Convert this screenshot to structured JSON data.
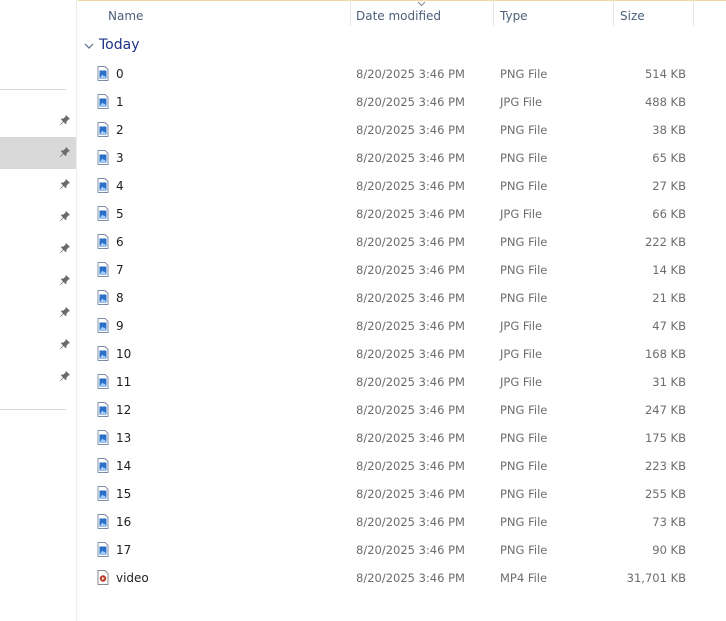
{
  "header": {
    "name": "Name",
    "date_modified": "Date modified",
    "type": "Type",
    "size": "Size"
  },
  "group": {
    "label": "Today"
  },
  "nav": {
    "pinned_count": 9,
    "selected_index": 1
  },
  "files": [
    {
      "name": "0",
      "date": "8/20/2025 3:46 PM",
      "type": "PNG File",
      "size": "514 KB",
      "icon": "image-file-icon"
    },
    {
      "name": "1",
      "date": "8/20/2025 3:46 PM",
      "type": "JPG File",
      "size": "488 KB",
      "icon": "image-file-icon"
    },
    {
      "name": "2",
      "date": "8/20/2025 3:46 PM",
      "type": "PNG File",
      "size": "38 KB",
      "icon": "image-file-icon"
    },
    {
      "name": "3",
      "date": "8/20/2025 3:46 PM",
      "type": "PNG File",
      "size": "65 KB",
      "icon": "image-file-icon"
    },
    {
      "name": "4",
      "date": "8/20/2025 3:46 PM",
      "type": "PNG File",
      "size": "27 KB",
      "icon": "image-file-icon"
    },
    {
      "name": "5",
      "date": "8/20/2025 3:46 PM",
      "type": "JPG File",
      "size": "66 KB",
      "icon": "image-file-icon"
    },
    {
      "name": "6",
      "date": "8/20/2025 3:46 PM",
      "type": "PNG File",
      "size": "222 KB",
      "icon": "image-file-icon"
    },
    {
      "name": "7",
      "date": "8/20/2025 3:46 PM",
      "type": "PNG File",
      "size": "14 KB",
      "icon": "image-file-icon"
    },
    {
      "name": "8",
      "date": "8/20/2025 3:46 PM",
      "type": "PNG File",
      "size": "21 KB",
      "icon": "image-file-icon"
    },
    {
      "name": "9",
      "date": "8/20/2025 3:46 PM",
      "type": "JPG File",
      "size": "47 KB",
      "icon": "image-file-icon"
    },
    {
      "name": "10",
      "date": "8/20/2025 3:46 PM",
      "type": "JPG File",
      "size": "168 KB",
      "icon": "image-file-icon"
    },
    {
      "name": "11",
      "date": "8/20/2025 3:46 PM",
      "type": "JPG File",
      "size": "31 KB",
      "icon": "image-file-icon"
    },
    {
      "name": "12",
      "date": "8/20/2025 3:46 PM",
      "type": "PNG File",
      "size": "247 KB",
      "icon": "image-file-icon"
    },
    {
      "name": "13",
      "date": "8/20/2025 3:46 PM",
      "type": "PNG File",
      "size": "175 KB",
      "icon": "image-file-icon"
    },
    {
      "name": "14",
      "date": "8/20/2025 3:46 PM",
      "type": "PNG File",
      "size": "223 KB",
      "icon": "image-file-icon"
    },
    {
      "name": "15",
      "date": "8/20/2025 3:46 PM",
      "type": "PNG File",
      "size": "255 KB",
      "icon": "image-file-icon"
    },
    {
      "name": "16",
      "date": "8/20/2025 3:46 PM",
      "type": "PNG File",
      "size": "73 KB",
      "icon": "image-file-icon"
    },
    {
      "name": "17",
      "date": "8/20/2025 3:46 PM",
      "type": "PNG File",
      "size": "90 KB",
      "icon": "image-file-icon"
    },
    {
      "name": "video",
      "date": "8/20/2025 3:46 PM",
      "type": "MP4 File",
      "size": "31,701 KB",
      "icon": "video-file-icon"
    }
  ],
  "colors": {
    "group_label": "#1e3287",
    "header_text": "#4c607a",
    "selected_nav": "#d9d9d9",
    "file_icon_blue": "#2a6fc9",
    "video_icon_red": "#c0392b"
  }
}
